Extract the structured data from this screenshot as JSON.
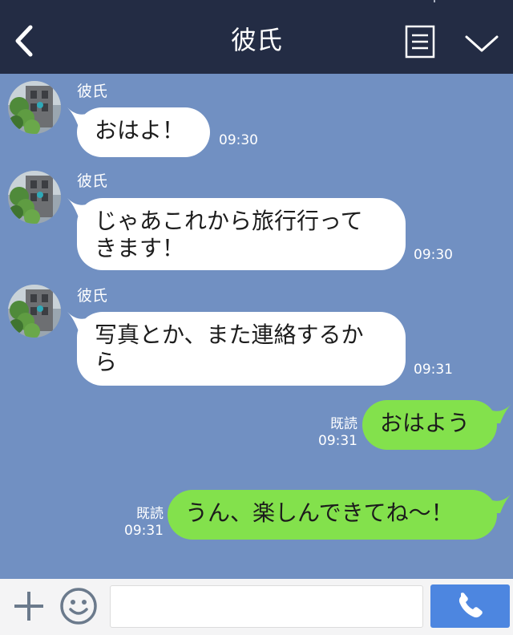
{
  "header": {
    "title": "彼氏",
    "back_icon": "chevron-left-icon",
    "menu_icon": "menu-list-icon",
    "dropdown_icon": "chevron-down-icon"
  },
  "messages": [
    {
      "direction": "in",
      "sender": "彼氏",
      "lines": [
        "おはよ！"
      ],
      "time": "09:30"
    },
    {
      "direction": "in",
      "sender": "彼氏",
      "lines": [
        "じゃあこれから旅行行って",
        "きます！"
      ],
      "time": "09:30"
    },
    {
      "direction": "in",
      "sender": "彼氏",
      "lines": [
        "写真とか、また連絡するか",
        "ら"
      ],
      "time": "09:31"
    },
    {
      "direction": "out",
      "lines": [
        "おはよう"
      ],
      "read": "既読",
      "time": "09:31"
    },
    {
      "direction": "out",
      "lines": [
        "うん、楽しんできてね～！"
      ],
      "read": "既読",
      "time": "09:31"
    }
  ],
  "input_bar": {
    "placeholder": "",
    "plus_icon": "plus-icon",
    "emoji_icon": "smiley-icon",
    "call_icon": "phone-icon"
  },
  "colors": {
    "header_bg": "#232c44",
    "chat_bg": "#7190c2",
    "incoming_bubble": "#ffffff",
    "outgoing_bubble": "#83e14c",
    "call_button": "#4d86e0"
  }
}
